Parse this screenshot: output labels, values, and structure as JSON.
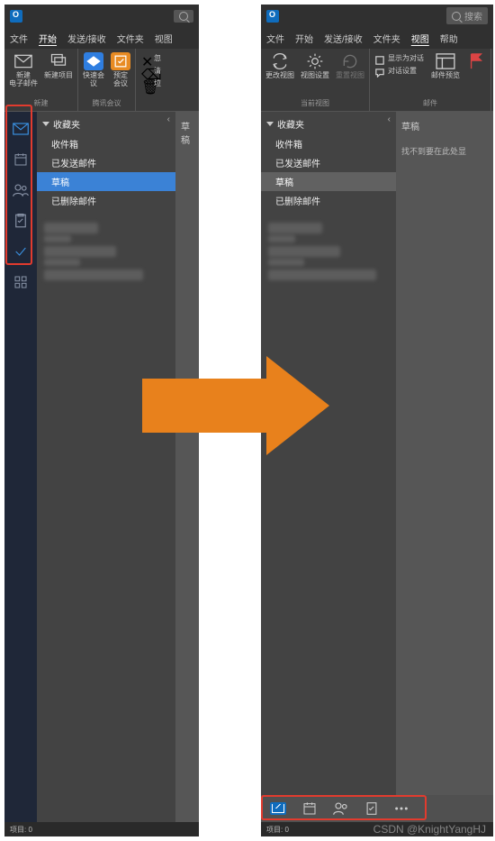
{
  "app_name": "Outlook",
  "search_placeholder": "搜索",
  "left": {
    "tabs": [
      "文件",
      "开始",
      "发送/接收",
      "文件夹",
      "视图"
    ],
    "active_tab": 1,
    "ribbon": {
      "groups": [
        {
          "label": "新建",
          "buttons": [
            {
              "label": "新建\n电子邮件",
              "icon": "mail"
            },
            {
              "label": "新建项目",
              "icon": "items"
            }
          ]
        },
        {
          "label": "腾讯会议",
          "buttons": [
            {
              "label": "快速会\n议",
              "icon": "quick",
              "bg": "blue"
            },
            {
              "label": "预定\n会议",
              "icon": "sched",
              "bg": "orange"
            }
          ]
        }
      ],
      "overflow": [
        {
          "label": "忽",
          "icon": "x"
        },
        {
          "label": "清",
          "icon": "x"
        },
        {
          "label": "垃",
          "icon": "x"
        }
      ]
    },
    "sidebar_icons": [
      "mail",
      "calendar",
      "people",
      "tasks",
      "todo",
      "more-grid"
    ],
    "favorites_header": "收藏夹",
    "folders": [
      "收件箱",
      "已发送邮件",
      "草稿",
      "已删除邮件"
    ],
    "selected_folder": 2,
    "msg_header": "草稿"
  },
  "right": {
    "tabs": [
      "文件",
      "开始",
      "发送/接收",
      "文件夹",
      "视图",
      "帮助"
    ],
    "active_tab": 4,
    "ribbon": {
      "groups": [
        {
          "label": "当前视图",
          "buttons": [
            {
              "label": "更改视图",
              "icon": "change"
            },
            {
              "label": "视图设置",
              "icon": "gear"
            },
            {
              "label": "重置视图",
              "icon": "reset",
              "disabled": true
            }
          ]
        },
        {
          "label": "邮件",
          "stack": [
            {
              "label": "显示为对话",
              "icon": "check"
            },
            {
              "label": "对话设置",
              "icon": "bubble"
            }
          ],
          "side": [
            {
              "label": "邮件预览",
              "icon": "preview"
            }
          ]
        }
      ]
    },
    "favorites_header": "收藏夹",
    "folders": [
      "收件箱",
      "已发送邮件",
      "草稿",
      "已删除邮件"
    ],
    "selected_folder": 2,
    "msg_header": "草稿",
    "msg_hint": "找不到要在此处显",
    "bottom_icons": [
      "mail",
      "calendar",
      "people",
      "tasks",
      "more"
    ],
    "status": "项目: 0"
  },
  "status_left": "项目: 0",
  "watermark": "CSDN @KnightYangHJ"
}
